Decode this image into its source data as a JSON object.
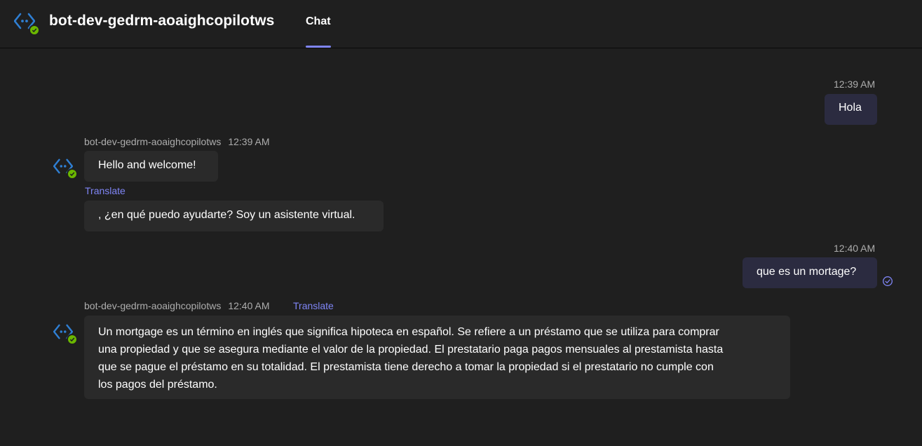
{
  "header": {
    "title": "bot-dev-gedrm-aoaighcopilotws",
    "tabs": [
      {
        "label": "Chat",
        "active": true
      }
    ]
  },
  "colors": {
    "background": "#1f1f1f",
    "user_bubble": "#2b2b40",
    "bot_bubble": "#2a2a2a",
    "accent": "#7f85f5",
    "bot_icon": "#2f7fd3",
    "status_green": "#6bb700"
  },
  "messages": {
    "m1": {
      "sender": "user",
      "time": "12:39 AM",
      "text": "Hola"
    },
    "m2": {
      "sender": "bot-dev-gedrm-aoaighcopilotws",
      "time": "12:39 AM",
      "text": "Hello and welcome!",
      "translate": "Translate"
    },
    "m3": {
      "sender": "bot",
      "text": ", ¿en qué puedo ayudarte? Soy un asistente virtual."
    },
    "m4": {
      "sender": "user",
      "time": "12:40 AM",
      "text": "que es un mortage?",
      "status_icon": "read-receipt-icon"
    },
    "m5": {
      "sender": "bot-dev-gedrm-aoaighcopilotws",
      "time": "12:40 AM",
      "translate": "Translate",
      "lines": [
        "Un mortgage es un término en inglés que significa hipoteca en español. Se refiere a un préstamo que se utiliza para comprar",
        "una propiedad y que se asegura mediante el valor de la propiedad. El prestatario paga pagos mensuales al prestamista hasta",
        "que se pague el préstamo en su totalidad. El prestamista tiene derecho a tomar la propiedad si el prestatario no cumple con",
        "los pagos del préstamo."
      ]
    }
  },
  "icons": {
    "app": "bot-icon",
    "status": "check-badge-icon",
    "read": "read-receipt-icon"
  }
}
